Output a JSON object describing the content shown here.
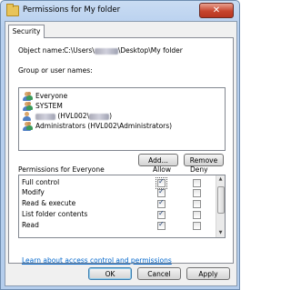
{
  "window": {
    "title": "Permissions for My folder",
    "close_glyph": "✕"
  },
  "tabs": [
    {
      "label": "Security"
    }
  ],
  "object": {
    "label": "Object name:",
    "path_prefix": "C:\\Users\\",
    "path_suffix": "\\Desktop\\My folder"
  },
  "principals": {
    "label": "Group or user names:",
    "items": [
      {
        "name": "Everyone",
        "icon": "group-icon"
      },
      {
        "name": "SYSTEM",
        "icon": "group-icon"
      },
      {
        "name_suffix": " (HVL002\\",
        "name_end": ")",
        "icon": "user-icon"
      },
      {
        "name": "Administrators (HVL002\\Administrators)",
        "icon": "group-icon"
      }
    ]
  },
  "buttons": {
    "add": "Add...",
    "remove": "Remove",
    "ok": "OK",
    "cancel": "Cancel",
    "apply": "Apply"
  },
  "permissions": {
    "label": "Permissions for Everyone",
    "allow_header": "Allow",
    "deny_header": "Deny",
    "rows": [
      {
        "name": "Full control",
        "allow": true,
        "deny": false
      },
      {
        "name": "Modify",
        "allow": true,
        "deny": false
      },
      {
        "name": "Read & execute",
        "allow": true,
        "deny": false
      },
      {
        "name": "List folder contents",
        "allow": true,
        "deny": false
      },
      {
        "name": "Read",
        "allow": true,
        "deny": false
      }
    ]
  },
  "help_link": "Learn about access control and permissions"
}
